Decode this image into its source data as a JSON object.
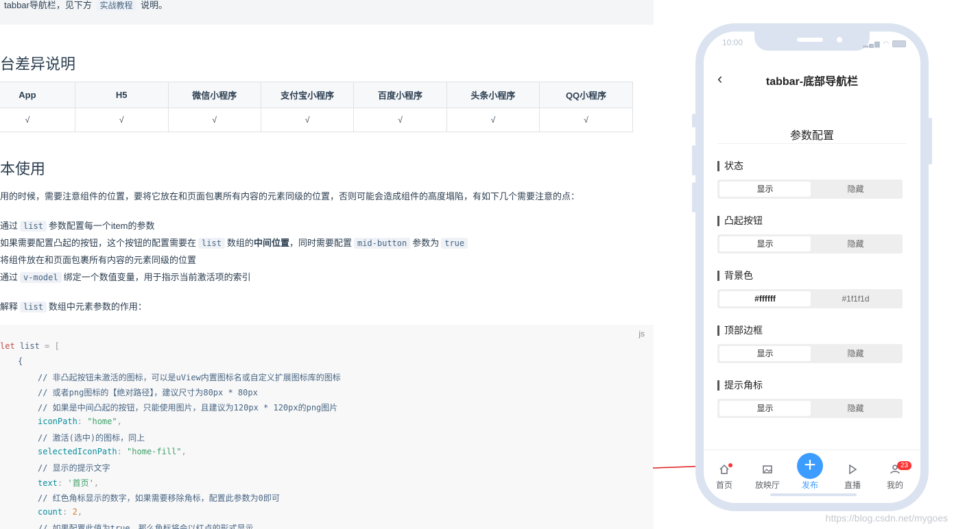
{
  "doc": {
    "tip": {
      "before": "tabbar导航栏，见下方",
      "code": "实战教程",
      "after": "说明。"
    },
    "platform_heading": "台差异说明",
    "platform_table": {
      "headers": [
        "App",
        "H5",
        "微信小程序",
        "支付宝小程序",
        "百度小程序",
        "头条小程序",
        "QQ小程序"
      ],
      "values": [
        "√",
        "√",
        "√",
        "√",
        "√",
        "√",
        "√"
      ]
    },
    "basic_heading": "本使用",
    "intro": "用的时候，需要注意组件的位置，要将它放在和页面包裹所有内容的元素同级的位置，否则可能会造成组件的高度塌陷，有如下几个需要注意的点：",
    "points": {
      "p1_a": "通过",
      "p1_code": "list",
      "p1_b": "参数配置每一个item的参数",
      "p2_a": "如果需要配置凸起的按钮，这个按钮的配置需要在",
      "p2_code1": "list",
      "p2_b": "数组的",
      "p2_bold": "中间位置",
      "p2_c": "，同时需要配置",
      "p2_code2": "mid-button",
      "p2_d": "参数为",
      "p2_code3": "true",
      "p3": "将组件放在和页面包裹所有内容的元素同级的位置",
      "p4_a": "通过",
      "p4_code": "v-model",
      "p4_b": "绑定一个数值变量，用于指示当前激活项的索引"
    },
    "explain": {
      "a": "解释",
      "code": "list",
      "b": "数组中元素参数的作用："
    },
    "code": {
      "lang": "js",
      "l1_kw": "let",
      "l1_var": " list",
      "l1_rest": " = [",
      "l2": "{",
      "l3": "// 非凸起按钮未激活的图标，可以是uView内置图标名或自定义扩展图标库的图标",
      "l4": "// 或者png图标的【绝对路径】，建议尺寸为80px * 80px",
      "l5": "// 如果是中间凸起的按钮，只能使用图片，且建议为120px * 120px的png图片",
      "l6_prop": "iconPath",
      "l6_val": "\"home\"",
      "l7": "// 激活(选中)的图标，同上",
      "l8_prop": "selectedIconPath",
      "l8_val": "\"home-fill\"",
      "l9": "// 显示的提示文字",
      "l10_prop": "text",
      "l10_val": "'首页'",
      "l11": "// 红色角标显示的数字，如果需要移除角标，配置此参数为0即可",
      "l12_prop": "count",
      "l12_val": "2",
      "l13": "// 如果配置此值为true，那么角标将会以红点的形式显示"
    }
  },
  "phone": {
    "time": "10:00",
    "nav_title": "tabbar-底部导航栏",
    "section_title": "参数配置",
    "options": [
      {
        "label": "状态",
        "a": "显示",
        "b": "隐藏"
      },
      {
        "label": "凸起按钮",
        "a": "显示",
        "b": "隐藏"
      },
      {
        "label": "背景色",
        "a": "#ffffff",
        "b": "#1f1f1d"
      },
      {
        "label": "顶部边框",
        "a": "显示",
        "b": "隐藏"
      },
      {
        "label": "提示角标",
        "a": "显示",
        "b": "隐藏"
      }
    ],
    "tabs": [
      {
        "label": "首页",
        "icon": "home-icon"
      },
      {
        "label": "放映厅",
        "icon": "image-icon"
      },
      {
        "label": "发布",
        "icon": "plus-icon"
      },
      {
        "label": "直播",
        "icon": "play-icon"
      },
      {
        "label": "我的",
        "icon": "user-icon",
        "badge": "23"
      }
    ],
    "colors": {
      "accent": "#3c9cff",
      "badge": "#fa3534",
      "frame": "#dbe3f1"
    }
  },
  "watermark": "https://blog.csdn.net/mygoes"
}
